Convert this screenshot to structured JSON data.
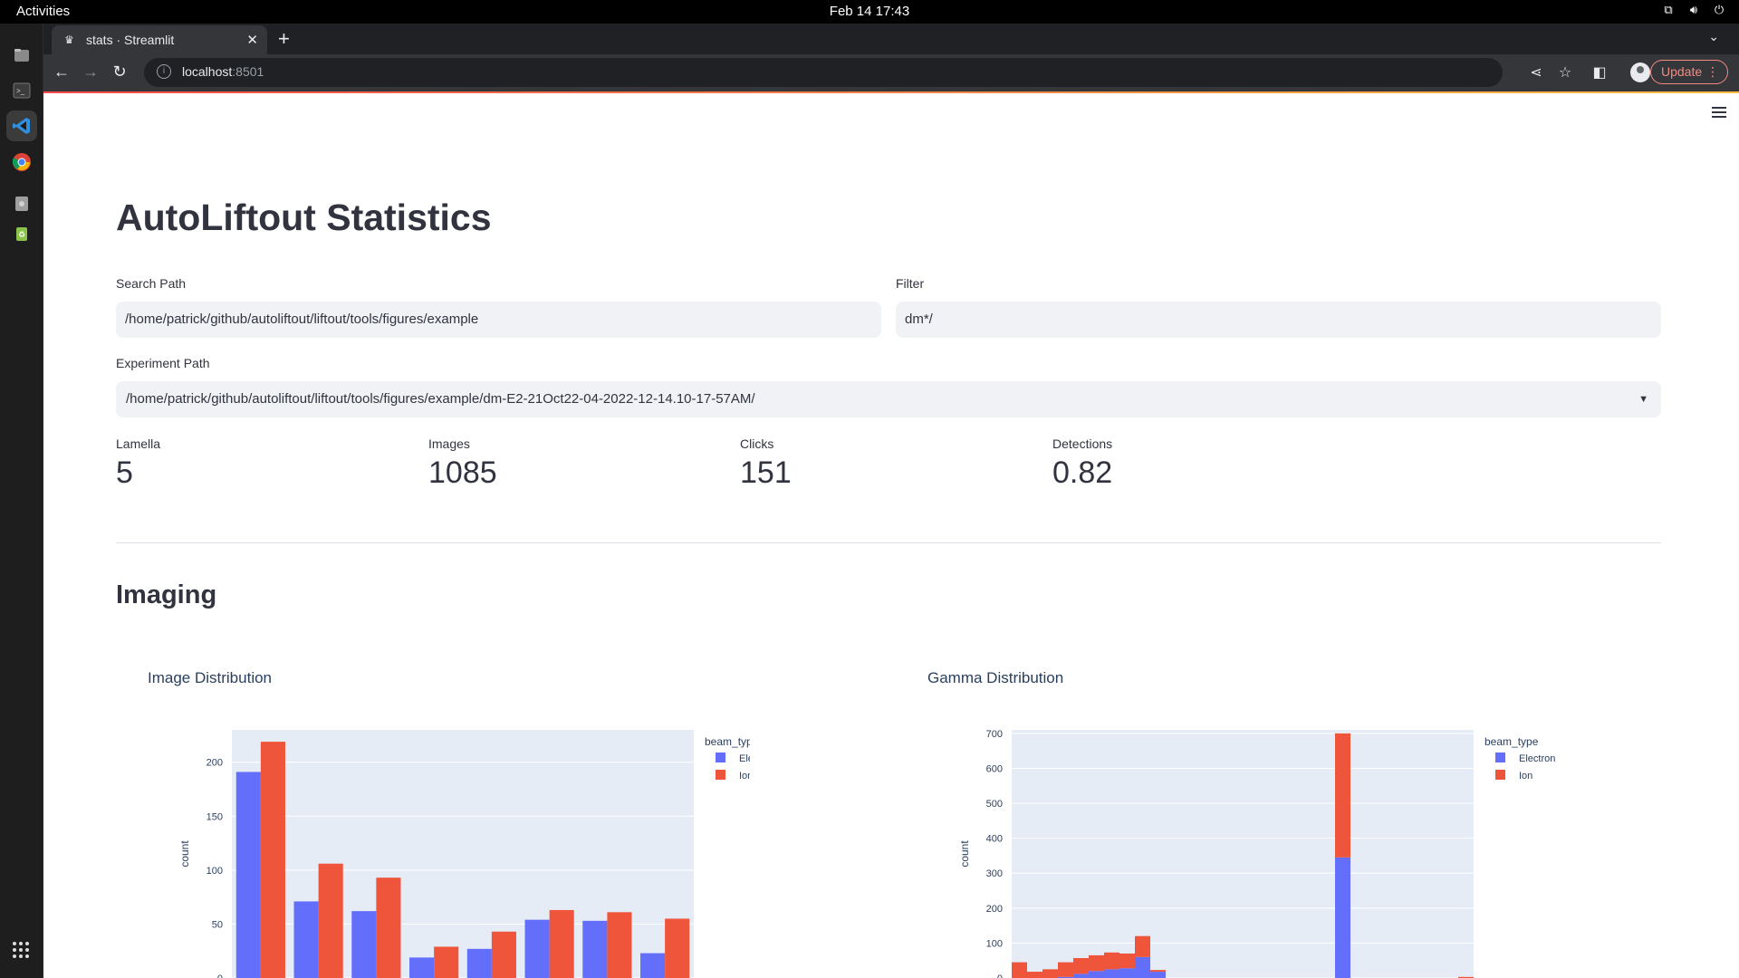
{
  "os": {
    "activities": "Activities",
    "clock": "Feb 14  17:43"
  },
  "browser": {
    "tab_title": "stats · Streamlit",
    "url_host": "localhost",
    "url_port": ":8501",
    "update_label": "Update"
  },
  "app": {
    "title": "AutoLiftout Statistics",
    "search_path_label": "Search Path",
    "search_path_value": "/home/patrick/github/autoliftout/liftout/tools/figures/example",
    "filter_label": "Filter",
    "filter_value": "dm*/",
    "experiment_path_label": "Experiment Path",
    "experiment_path_value": "/home/patrick/github/autoliftout/liftout/tools/figures/example/dm-E2-21Oct22-04-2022-12-14.10-17-57AM/",
    "metrics": [
      {
        "label": "Lamella",
        "value": "5"
      },
      {
        "label": "Images",
        "value": "1085"
      },
      {
        "label": "Clicks",
        "value": "151"
      },
      {
        "label": "Detections",
        "value": "0.82"
      }
    ],
    "section_title": "Imaging"
  },
  "colors": {
    "electron": "#636efa",
    "ion": "#ef553b",
    "plot_bg": "#e5ecf6"
  },
  "chart_data": [
    {
      "type": "bar",
      "title": "Image Distribution",
      "ylabel": "count",
      "legend_title": "beam_type",
      "legend_placement": "top-right",
      "ylim": [
        0,
        230
      ],
      "yticks": [
        0,
        50,
        100,
        150,
        200
      ],
      "series": [
        {
          "name": "Electron",
          "values": [
            191,
            71,
            62,
            19,
            27,
            54,
            53,
            23
          ]
        },
        {
          "name": "Ion",
          "values": [
            219,
            106,
            93,
            29,
            43,
            63,
            61,
            55
          ]
        }
      ]
    },
    {
      "type": "bar",
      "title": "Gamma Distribution",
      "ylabel": "count",
      "legend_title": "beam_type",
      "legend_placement": "top-right",
      "ylim": [
        0,
        710
      ],
      "yticks": [
        0,
        100,
        200,
        300,
        400,
        500,
        600,
        700
      ],
      "stacked": true,
      "series": [
        {
          "name": "Electron",
          "values": [
            0,
            0,
            0,
            3,
            12,
            20,
            25,
            28,
            60,
            18,
            0,
            0,
            0,
            0,
            0,
            0,
            0,
            0,
            0,
            0,
            0,
            345,
            0,
            0,
            0,
            0,
            0,
            0,
            0,
            0
          ]
        },
        {
          "name": "Ion",
          "values": [
            45,
            18,
            25,
            42,
            45,
            45,
            48,
            42,
            60,
            5,
            0,
            0,
            0,
            0,
            0,
            0,
            0,
            0,
            0,
            0,
            0,
            355,
            0,
            0,
            0,
            0,
            0,
            0,
            0,
            3
          ]
        }
      ]
    }
  ]
}
